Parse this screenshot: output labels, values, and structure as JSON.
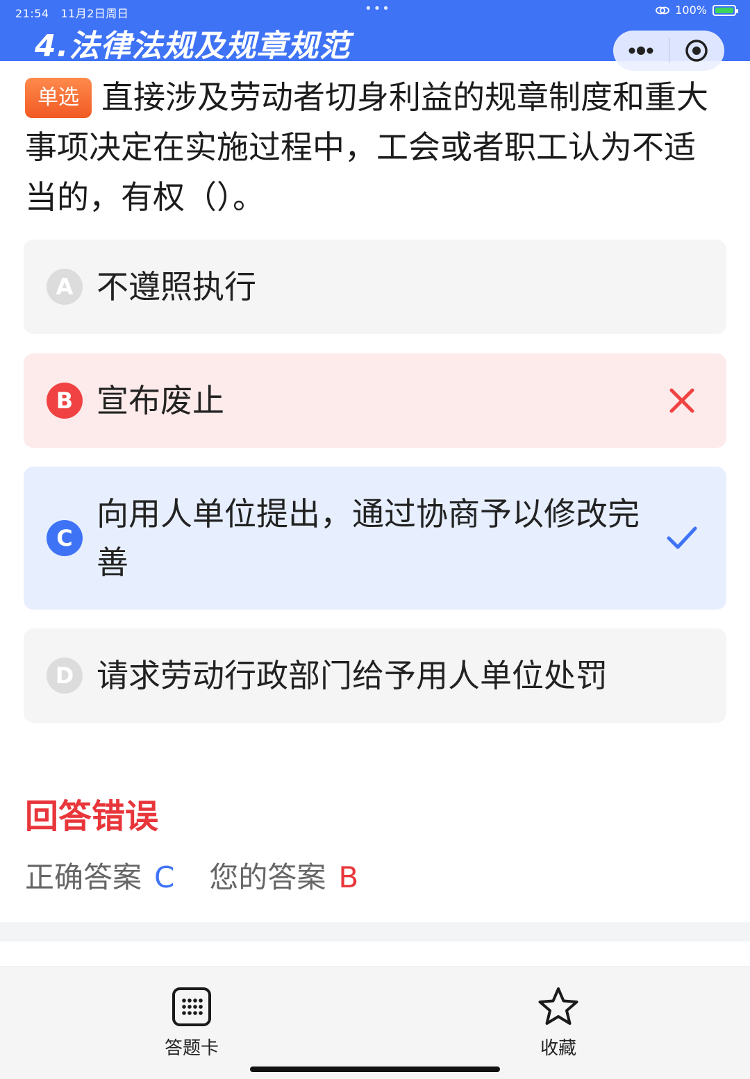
{
  "status_bar": {
    "time": "21:54",
    "date": "11月2日周日",
    "dots": "•••",
    "battery": "100%"
  },
  "header": {
    "title": "4.法律法规及规章规范",
    "more_icon": "more-dots-icon",
    "close_icon": "target-close-icon"
  },
  "question": {
    "type_tag": "单选",
    "text": "直接涉及劳动者切身利益的规章制度和重大事项决定在实施过程中，工会或者职工认为不适当的，有权（）。"
  },
  "options": [
    {
      "letter": "A",
      "text": "不遵照执行",
      "state": "normal"
    },
    {
      "letter": "B",
      "text": "宣布废止",
      "state": "wrong"
    },
    {
      "letter": "C",
      "text": "向用人单位提出，通过协商予以修改完善",
      "state": "correct"
    },
    {
      "letter": "D",
      "text": "请求劳动行政部门给予用人单位处罚",
      "state": "normal"
    }
  ],
  "result": {
    "title": "回答错误",
    "correct_label": "正确答案",
    "correct_value": "C",
    "yours_label": "您的答案",
    "yours_value": "B"
  },
  "bottom_bar": {
    "answer_card_label": "答题卡",
    "favorite_label": "收藏"
  },
  "colors": {
    "primary": "#3f73f6",
    "error": "#e8363b",
    "tag_orange": "#f15a24",
    "wrong_bg": "#fdeaea",
    "correct_bg": "#e7efff"
  }
}
